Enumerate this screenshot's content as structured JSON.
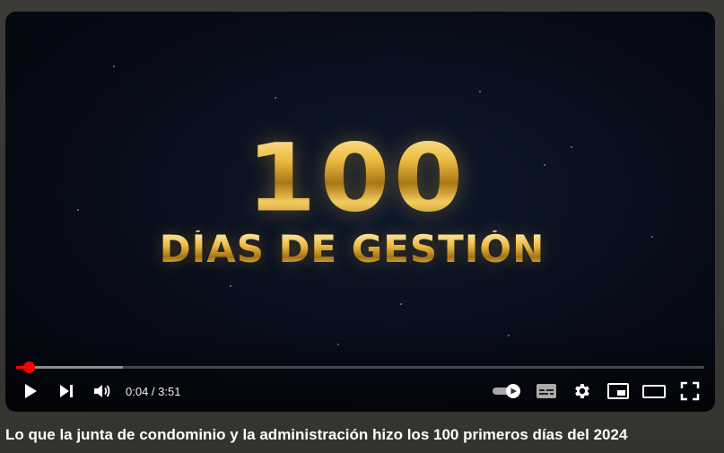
{
  "video": {
    "overlay_number": "100",
    "overlay_subtitle": "DÍAS DE GESTIÓN",
    "progress_fraction": 0.018,
    "buffered_fraction": 0.155
  },
  "controls": {
    "time_display": "0:04 / 3:51",
    "icons": {
      "play": "play-icon",
      "next": "next-icon",
      "volume": "volume-icon",
      "autoplay": "autoplay-toggle-icon",
      "subtitles": "subtitles-icon",
      "settings": "gear-icon",
      "miniplayer": "miniplayer-icon",
      "theater": "theater-mode-icon",
      "fullscreen": "fullscreen-icon"
    }
  },
  "title": "Lo que la junta de condominio y la administración hizo los 100 primeros días del 2024",
  "colors": {
    "progress": "#ff0000",
    "gold": "#d8a634"
  }
}
